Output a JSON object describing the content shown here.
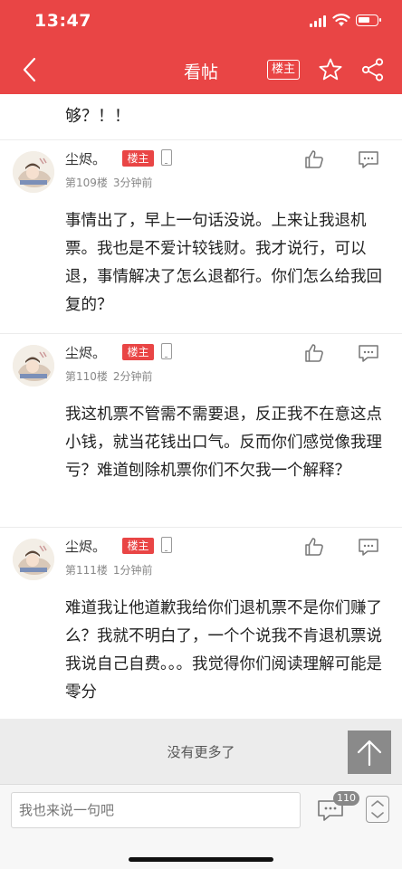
{
  "status": {
    "time": "13:47"
  },
  "header": {
    "title": "看帖",
    "owner_box": "楼主"
  },
  "prev_tail": "够？！！",
  "posts": [
    {
      "name": "尘烬。",
      "badge": "楼主",
      "floor": "第109楼",
      "time": "3分钟前",
      "text": "事情出了，早上一句话没说。上来让我退机票。我也是不爱计较钱财。我才说行，可以退，事情解决了怎么退都行。你们怎么给我回复的？"
    },
    {
      "name": "尘烬。",
      "badge": "楼主",
      "floor": "第110楼",
      "time": "2分钟前",
      "text": "我这机票不管需不需要退，反正我不在意这点小钱，就当花钱出口气。反而你们感觉像我理亏？难道刨除机票你们不欠我一个解释？"
    },
    {
      "name": "尘烬。",
      "badge": "楼主",
      "floor": "第111楼",
      "time": "1分钟前",
      "text": "难道我让他道歉我给你们退机票不是你们赚了么？我就不明白了，一个个说我不肯退机票说我说自己自费。。。我觉得你们阅读理解可能是零分"
    }
  ],
  "footer": {
    "no_more": "没有更多了"
  },
  "bottombar": {
    "input_placeholder": "我也来说一句吧",
    "comment_count": "110"
  },
  "icons": [
    "back-icon",
    "star-icon",
    "share-icon",
    "like-icon",
    "reply-icon",
    "phone-icon",
    "arrow-up-icon",
    "comment-icon",
    "scroll-icon"
  ],
  "colors": {
    "brand": "#e94545",
    "badge": "#e94545",
    "muted": "#888888"
  }
}
